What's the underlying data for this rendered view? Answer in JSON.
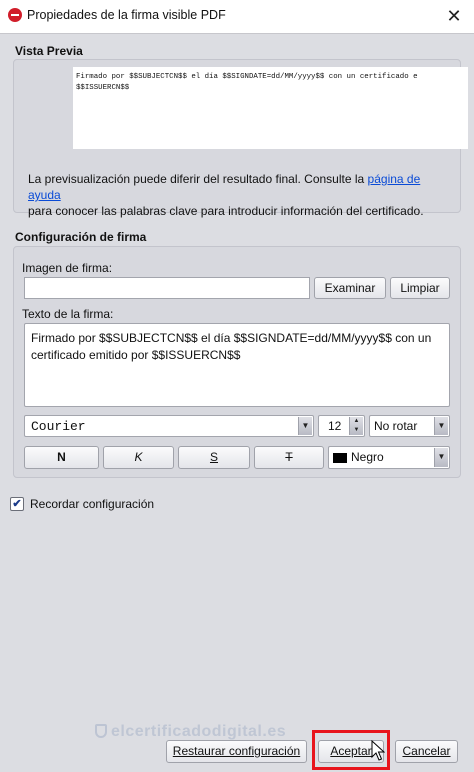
{
  "window": {
    "title": "Propiedades de la firma visible PDF",
    "close_glyph": "✕"
  },
  "preview": {
    "section_title": "Vista Previa",
    "preview_text": "Firmado por $$SUBJECTCN$$ el día $$SIGNDATE=dd/MM/yyyy$$ con un certificado e\n$$ISSUERCN$$",
    "help_before_link": "La previsualización puede diferir del resultado final. Consulte la ",
    "help_link": "página de ayuda",
    "help_after_link": "para conocer las palabras clave para introducir información del certificado."
  },
  "config": {
    "section_title": "Configuración de firma",
    "image_label": "Imagen de firma:",
    "image_value": "",
    "browse_label": "Examinar",
    "clear_label": "Limpiar",
    "text_label": "Texto de la firma:",
    "text_value": "Firmado por $$SUBJECTCN$$ el día $$SIGNDATE=dd/MM/yyyy$$ con un certificado emitido por $$ISSUERCN$$",
    "font_value": "Courier",
    "font_size": "12",
    "rotation_value": "No rotar",
    "bold_label": "N",
    "italic_label": "K",
    "underline_label": "S",
    "strike_label": "T",
    "color_value": "Negro",
    "color_swatch": "#000000"
  },
  "remember": {
    "label": "Recordar configuración",
    "checked": true,
    "check_glyph": "✔"
  },
  "footer": {
    "restore_label": "Restaurar configuración",
    "accept_label": "Aceptar",
    "cancel_label": "Cancelar",
    "watermark": "elcertificadodigital.es"
  },
  "colors": {
    "highlight": "#e8141c",
    "link": "#0a4bd6"
  }
}
